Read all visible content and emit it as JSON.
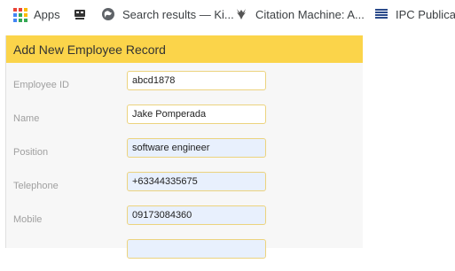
{
  "bookmarks": {
    "apps": "Apps",
    "item1": "",
    "item2": "Search results — Ki...",
    "item3": "Citation Machine: A...",
    "item4": "IPC Publicatio"
  },
  "icons": {
    "apps": "apps-grid-icon",
    "bookmark1": "robot-icon",
    "bookmark2": "globe-icon",
    "bookmark3": "antler-icon",
    "bookmark4": "ipc-logo-icon"
  },
  "colors": {
    "header_bg": "#fbd44a",
    "field_border": "#ecd37e",
    "autofill_bg": "#e8f0fd",
    "label_text": "#a0a0a0"
  },
  "form": {
    "title": "Add New Employee Record",
    "fields": [
      {
        "label": "Employee ID",
        "value": "abcd1878"
      },
      {
        "label": "Name",
        "value": "Jake Pomperada"
      },
      {
        "label": "Position",
        "value": "software engineer"
      },
      {
        "label": "Telephone",
        "value": "+63344335675"
      },
      {
        "label": "Mobile",
        "value": "09173084360"
      }
    ]
  }
}
